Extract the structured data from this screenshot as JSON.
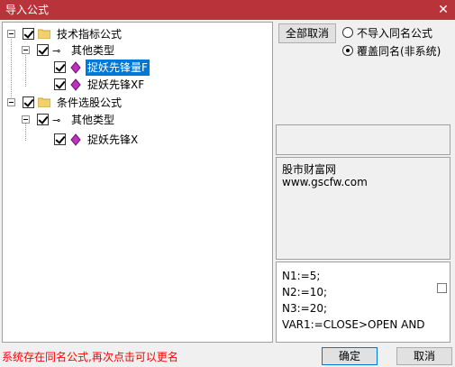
{
  "window": {
    "title": "导入公式"
  },
  "tree": {
    "groups": [
      {
        "label": "技术指标公式",
        "sub": "其他类型",
        "items": [
          "捉妖先锋量F",
          "捉妖先锋XF"
        ]
      },
      {
        "label": "条件选股公式",
        "sub": "其他类型",
        "items": [
          "捉妖先锋X"
        ]
      }
    ]
  },
  "controls": {
    "cancel_all": "全部取消",
    "radio_no_import": "不导入同名公式",
    "radio_overwrite": "覆盖同名(非系统)",
    "selected": "radio_overwrite"
  },
  "info": {
    "line1": "股市财富网",
    "line2": "www.gscfw.com"
  },
  "code": [
    "N1:=5;",
    "N2:=10;",
    "N3:=20;",
    "VAR1:=CLOSE>OPEN AND"
  ],
  "status_msg": "系统存在同名公式,再次点击可以更名",
  "buttons": {
    "ok": "确定",
    "cancel": "取消"
  },
  "colors": {
    "titlebar": "#b9333a",
    "selection": "#0078d7",
    "status": "#ff0000"
  }
}
